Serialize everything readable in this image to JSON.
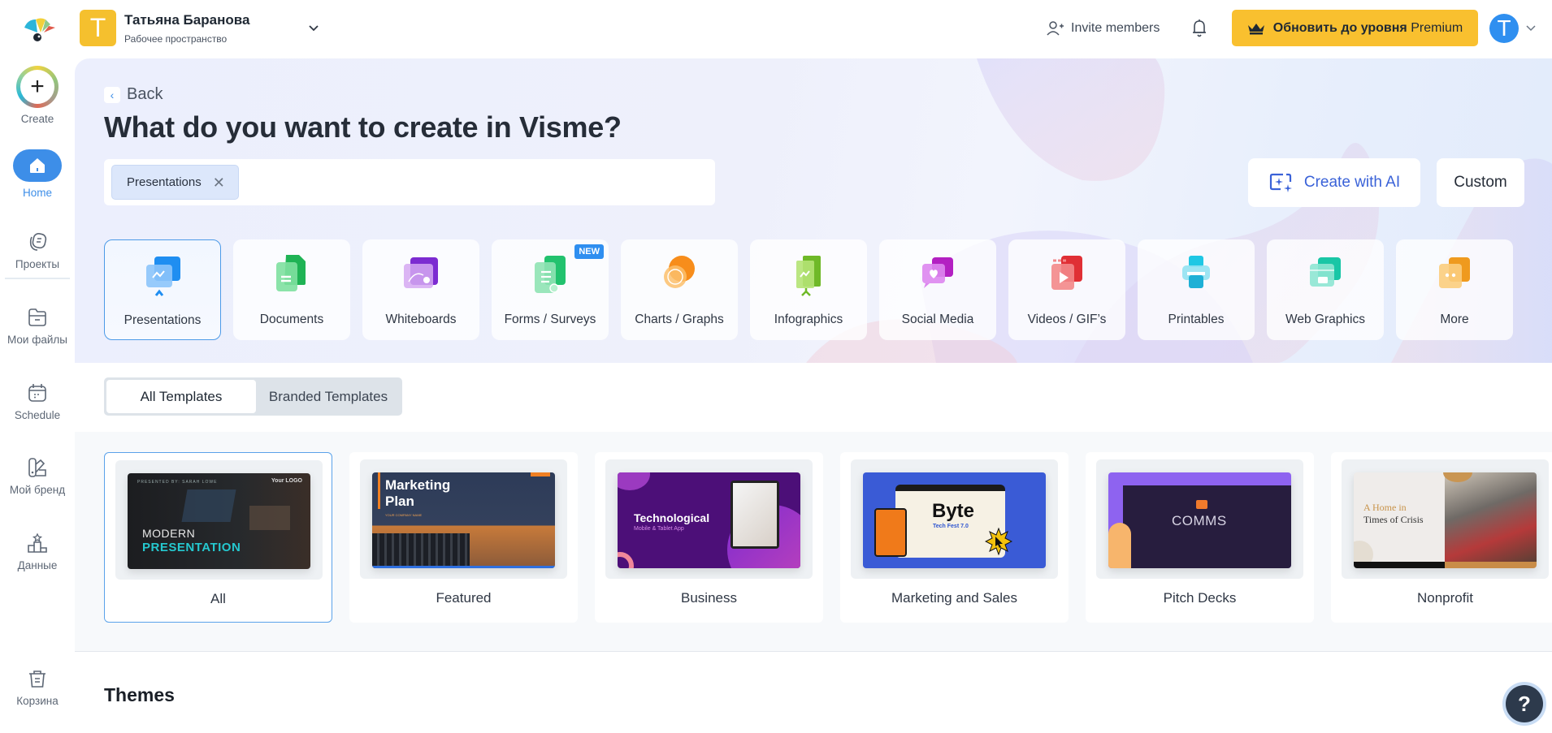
{
  "header": {
    "workspace_initial": "T",
    "workspace_name": "Татьяна Баранова",
    "workspace_subtitle": "Рабочее пространство",
    "invite_label": "Invite members",
    "premium_label_bold": "Обновить до уровня",
    "premium_label_rest": "Premium",
    "user_initial": "T"
  },
  "sidebar": {
    "create_label": "Create",
    "items": [
      {
        "label": "Home",
        "icon": "home-icon",
        "active": true
      },
      {
        "label": "Проекты",
        "icon": "projects-icon"
      },
      {
        "label": "Мои файлы",
        "icon": "folder-icon"
      },
      {
        "label": "Schedule",
        "icon": "calendar-icon"
      },
      {
        "label": "Мой бренд",
        "icon": "brand-icon"
      },
      {
        "label": "Данные",
        "icon": "data-icon"
      }
    ],
    "trash_label": "Корзина"
  },
  "hero": {
    "back_label": "Back",
    "title": "What do you want to create in Visme?",
    "search_chip": "Presentations",
    "create_ai_label": "Create with AI",
    "custom_label": "Custom",
    "categories": [
      {
        "label": "Presentations",
        "icon": "presentation-icon",
        "color": "#2f8ff0",
        "selected": true
      },
      {
        "label": "Documents",
        "icon": "document-icon",
        "color": "#22b85a"
      },
      {
        "label": "Whiteboards",
        "icon": "whiteboard-icon",
        "color": "#8a3bd6"
      },
      {
        "label": "Forms / Surveys",
        "icon": "forms-icon",
        "color": "#2fc47a",
        "badge": "NEW"
      },
      {
        "label": "Charts / Graphs",
        "icon": "chart-icon",
        "color": "#f7901e"
      },
      {
        "label": "Infographics",
        "icon": "infographic-icon",
        "color": "#7cc528"
      },
      {
        "label": "Social Media",
        "icon": "social-media-icon",
        "color": "#c026c9"
      },
      {
        "label": "Videos / GIF’s",
        "icon": "video-icon",
        "color": "#e3363a"
      },
      {
        "label": "Printables",
        "icon": "printer-icon",
        "color": "#22c3e0"
      },
      {
        "label": "Web Graphics",
        "icon": "web-graphics-icon",
        "color": "#20c9a8"
      },
      {
        "label": "More",
        "icon": "more-icon",
        "color": "#f3a22c"
      }
    ]
  },
  "tabs": {
    "all": "All Templates",
    "branded": "Branded Templates"
  },
  "templates": [
    {
      "label": "All",
      "thumb": {
        "top": "PRESENTED BY: SARAH LOWE",
        "line1": "MODERN",
        "line2": "PRESENTATION",
        "logo": "Your LOGO"
      }
    },
    {
      "label": "Featured",
      "thumb": {
        "line1": "Marketing",
        "line2": "Plan",
        "sub": "YOUR COMPANY NAME"
      }
    },
    {
      "label": "Business",
      "thumb": {
        "line1": "Technological",
        "sub": "Mobile & Tablet App"
      }
    },
    {
      "label": "Marketing and Sales",
      "thumb": {
        "line1": "Byte",
        "sub": "Tech Fest 7.0"
      }
    },
    {
      "label": "Pitch Decks",
      "thumb": {
        "line1": "COMMS"
      }
    },
    {
      "label": "Nonprofit",
      "thumb": {
        "line1": "A Home in",
        "line2": "Times of Crisis"
      }
    }
  ],
  "themes_heading": "Themes",
  "help_label": "?"
}
